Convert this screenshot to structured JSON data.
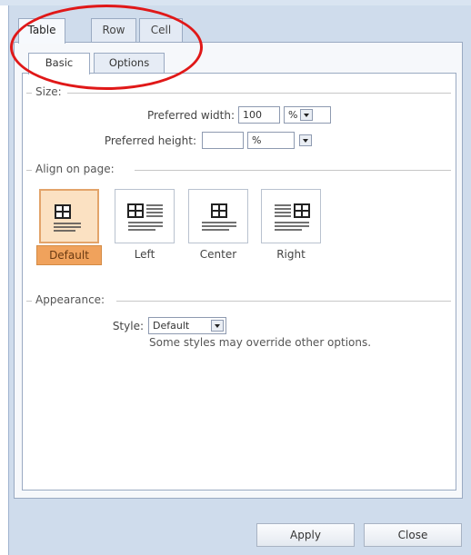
{
  "tabs": [
    "Table",
    "Row",
    "Cell"
  ],
  "subtabs": [
    "Basic",
    "Options"
  ],
  "size": {
    "section_title": "Size:",
    "preferred_width_label": "Preferred width:",
    "preferred_width_value": "100",
    "preferred_width_unit": "%",
    "preferred_height_label": "Preferred height:",
    "preferred_height_value": "",
    "preferred_height_unit": "%"
  },
  "align": {
    "section_title": "Align on page:",
    "options": [
      "Default",
      "Left",
      "Center",
      "Right"
    ],
    "selected": "Default"
  },
  "appearance": {
    "section_title": "Appearance:",
    "style_label": "Style:",
    "style_value": "Default",
    "note": "Some styles may override other options."
  },
  "footer": {
    "apply_label": "Apply",
    "close_label": "Close"
  },
  "colors": {
    "selection_fill": "#f0a25c",
    "annotation_oval": "#e01818",
    "frame": "#cfdcec"
  }
}
